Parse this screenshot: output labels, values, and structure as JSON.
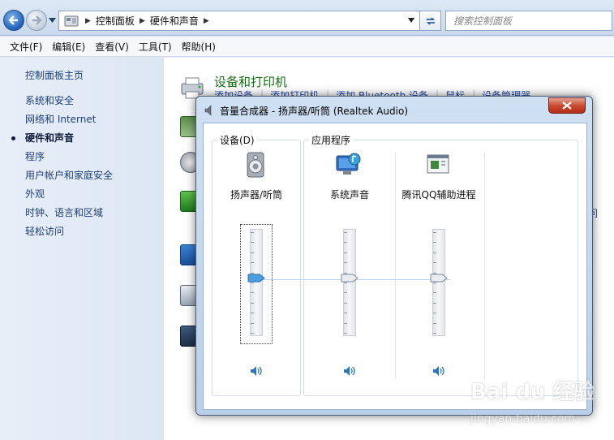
{
  "explorer": {
    "breadcrumbs": [
      "控制面板",
      "硬件和声音"
    ],
    "search_placeholder": "搜索控制面板",
    "menu": [
      "文件(F)",
      "编辑(E)",
      "查看(V)",
      "工具(T)",
      "帮助(H)"
    ],
    "nav_home": "控制面板主页",
    "nav_items": [
      {
        "label": "系统和安全",
        "current": false
      },
      {
        "label": "网络和 Internet",
        "current": false
      },
      {
        "label": "硬件和声音",
        "current": true
      },
      {
        "label": "程序",
        "current": false
      },
      {
        "label": "用户帐户和家庭安全",
        "current": false
      },
      {
        "label": "外观",
        "current": false
      },
      {
        "label": "时钟、语言和区域",
        "current": false
      },
      {
        "label": "轻松访问",
        "current": false
      }
    ],
    "category": {
      "title": "设备和打印机",
      "links": [
        "添加设备",
        "添加打印机",
        "添加 Bluetooth 设备",
        "鼠标",
        "设备管理器"
      ]
    },
    "right_fragment": "问"
  },
  "mixer": {
    "title": "音量合成器 - 扬声器/听筒 (Realtek Audio)",
    "devices_group": "设备(D)",
    "apps_group": "应用程序",
    "channels": [
      {
        "name": "扬声器/听筒",
        "icon": "speaker-device-icon",
        "volume": 0.55,
        "focused": true
      },
      {
        "name": "系统声音",
        "icon": "system-sounds-icon",
        "volume": 0.55,
        "focused": false
      },
      {
        "name": "腾讯QQ辅助进程",
        "icon": "qq-helper-icon",
        "volume": 0.55,
        "focused": false
      }
    ],
    "colors": {
      "accent": "#4a9fe0",
      "close": "#c6452c"
    }
  },
  "watermark": {
    "logo": "Bai du 经验",
    "url": "jingyan.baidu.com"
  }
}
